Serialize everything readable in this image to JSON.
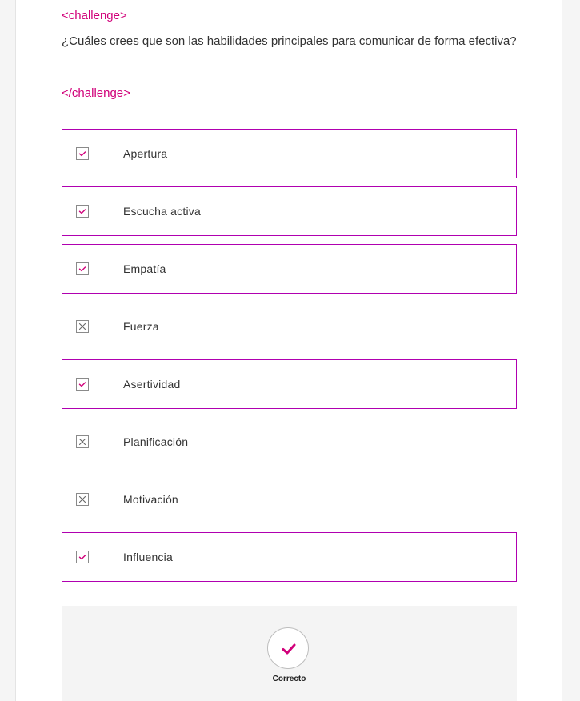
{
  "challenge": {
    "open_tag": "<challenge>",
    "question": "¿Cuáles crees que son las habilidades principales para comunicar de forma efectiva?",
    "close_tag": "</challenge>"
  },
  "options": [
    {
      "label": "Apertura",
      "state": "checked"
    },
    {
      "label": "Escucha activa",
      "state": "checked"
    },
    {
      "label": "Empatía",
      "state": "checked"
    },
    {
      "label": "Fuerza",
      "state": "crossed"
    },
    {
      "label": "Asertividad",
      "state": "checked"
    },
    {
      "label": "Planificación",
      "state": "crossed"
    },
    {
      "label": "Motivación",
      "state": "crossed"
    },
    {
      "label": "Influencia",
      "state": "checked"
    }
  ],
  "feedback": {
    "icon": "checkmark-icon",
    "label": "Correcto"
  },
  "colors": {
    "accent": "#d1007a",
    "selected_border": "#b000b0",
    "feedback_bg": "#f4f4f4"
  }
}
